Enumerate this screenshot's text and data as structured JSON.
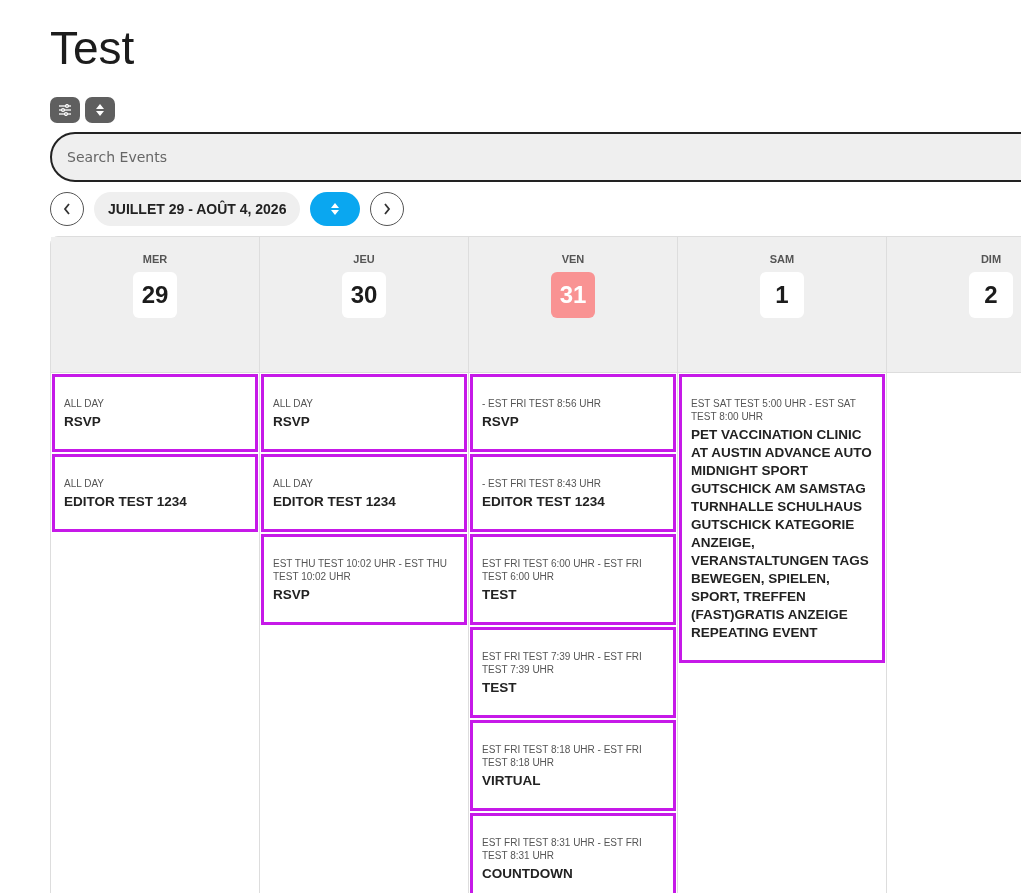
{
  "title": "Test",
  "toolbar": {
    "search": {
      "placeholder": "Search Events"
    },
    "range": "JUILLET 29 - AOÛT 4, 2026"
  },
  "days": [
    {
      "name": "MER",
      "date": "29",
      "today": false,
      "events": [
        {
          "time": "ALL DAY",
          "title": "RSVP"
        },
        {
          "time": "ALL DAY",
          "title": "EDITOR TEST 1234"
        }
      ]
    },
    {
      "name": "JEU",
      "date": "30",
      "today": false,
      "events": [
        {
          "time": "ALL DAY",
          "title": "RSVP"
        },
        {
          "time": "ALL DAY",
          "title": "EDITOR TEST 1234"
        },
        {
          "time": "EST THU TEST 10:02 UHR - EST THU TEST 10:02 UHR",
          "title": "RSVP"
        }
      ]
    },
    {
      "name": "VEN",
      "date": "31",
      "today": true,
      "events": [
        {
          "time": "- EST FRI TEST 8:56 UHR",
          "title": "RSVP"
        },
        {
          "time": "- EST FRI TEST 8:43 UHR",
          "title": "EDITOR TEST 1234"
        },
        {
          "time": "EST FRI TEST 6:00 UHR - EST FRI TEST 6:00 UHR",
          "title": "TEST"
        },
        {
          "time": "EST FRI TEST 7:39 UHR - EST FRI TEST 7:39 UHR",
          "title": "TEST"
        },
        {
          "time": "EST FRI TEST 8:18 UHR - EST FRI TEST 8:18 UHR",
          "title": "VIRTUAL"
        },
        {
          "time": "EST FRI TEST 8:31 UHR - EST FRI TEST 8:31 UHR",
          "title": "COUNTDOWN"
        }
      ]
    },
    {
      "name": "SAM",
      "date": "1",
      "today": false,
      "events": [
        {
          "time": "EST SAT TEST 5:00 UHR - EST SAT TEST 8:00 UHR",
          "title": "PET VACCINATION CLINIC AT AUSTIN ADVANCE AUTO MIDNIGHT SPORT GUTSCHICK AM SAMSTAG TURNHALLE SCHULHAUS GUTSCHICK KATEGORIE ANZEIGE, VERANSTALTUNGEN TAGS BEWEGEN, SPIELEN, SPORT, TREFFEN (FAST)GRATIS ANZEIGE REPEATING EVENT"
        }
      ]
    },
    {
      "name": "DIM",
      "date": "2",
      "today": false
    }
  ]
}
